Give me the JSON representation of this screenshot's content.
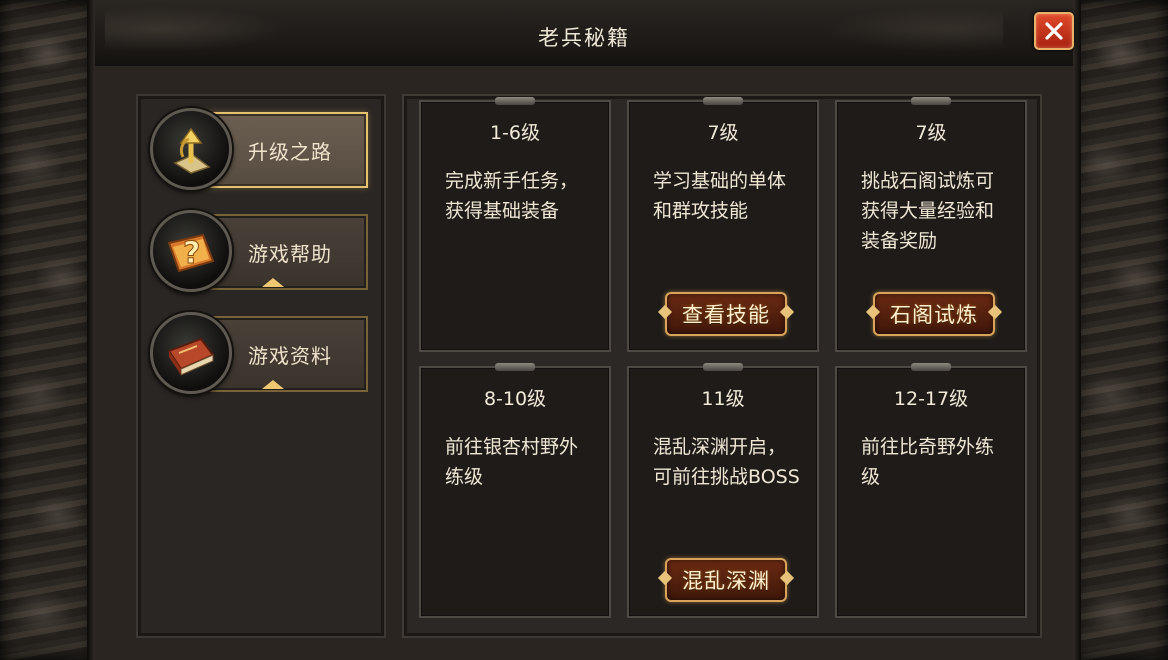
{
  "window": {
    "title": "老兵秘籍"
  },
  "sidebar": {
    "tabs": [
      {
        "label": "升级之路",
        "active": true,
        "icon": "upgrade-arrow-icon"
      },
      {
        "label": "游戏帮助",
        "active": false,
        "icon": "help-scroll-icon"
      },
      {
        "label": "游戏资料",
        "active": false,
        "icon": "book-icon"
      }
    ]
  },
  "cards": [
    {
      "level": "1-6级",
      "desc": "完成新手任务，获得基础装备"
    },
    {
      "level": "7级",
      "desc": "学习基础的单体和群攻技能",
      "button": "查看技能"
    },
    {
      "level": "7级",
      "desc": "挑战石阁试炼可获得大量经验和装备奖励",
      "button": "石阁试炼"
    },
    {
      "level": "8-10级",
      "desc": "前往银杏村野外练级"
    },
    {
      "level": "11级",
      "desc": "混乱深渊开启，可前往挑战BOSS",
      "button": "混乱深渊"
    },
    {
      "level": "12-17级",
      "desc": "前往比奇野外练级"
    }
  ],
  "colors": {
    "accent_gold": "#e4c26e",
    "close_red": "#c8331a",
    "panel_dark": "#1e1b19"
  }
}
